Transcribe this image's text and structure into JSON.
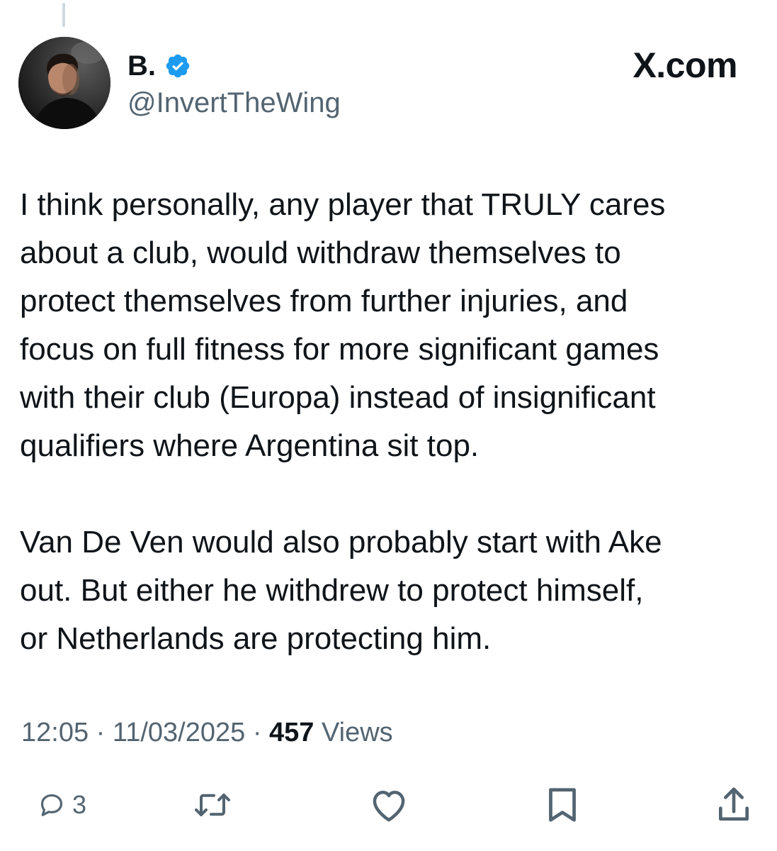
{
  "author": {
    "display_name": "B.",
    "handle": "@InvertTheWing",
    "verified": true,
    "avatar_icon": "profile-photo"
  },
  "brand": {
    "label": "X.com"
  },
  "tweet": {
    "paragraphs": [
      "I think personally, any player that TRULY cares\nabout a club, would withdraw themselves to\nprotect themselves from further injuries, and\nfocus on full fitness for more significant games\nwith their club (Europa) instead of insignificant\nqualifiers where Argentina sit top.",
      "Van De Ven would also probably start with Ake\nout. But either he withdrew to protect himself,\nor Netherlands are protecting him."
    ]
  },
  "meta": {
    "time": "12:05",
    "separator": "·",
    "date": "11/03/2025",
    "views_count": "457",
    "views_label": "Views"
  },
  "actions": {
    "reply_count": "3",
    "reply_icon": "reply-icon",
    "repost_icon": "repost-icon",
    "like_icon": "heart-icon",
    "bookmark_icon": "bookmark-icon",
    "share_icon": "share-icon"
  },
  "colors": {
    "text": "#0f1419",
    "secondary": "#536471",
    "verified": "#1d9bf0"
  }
}
